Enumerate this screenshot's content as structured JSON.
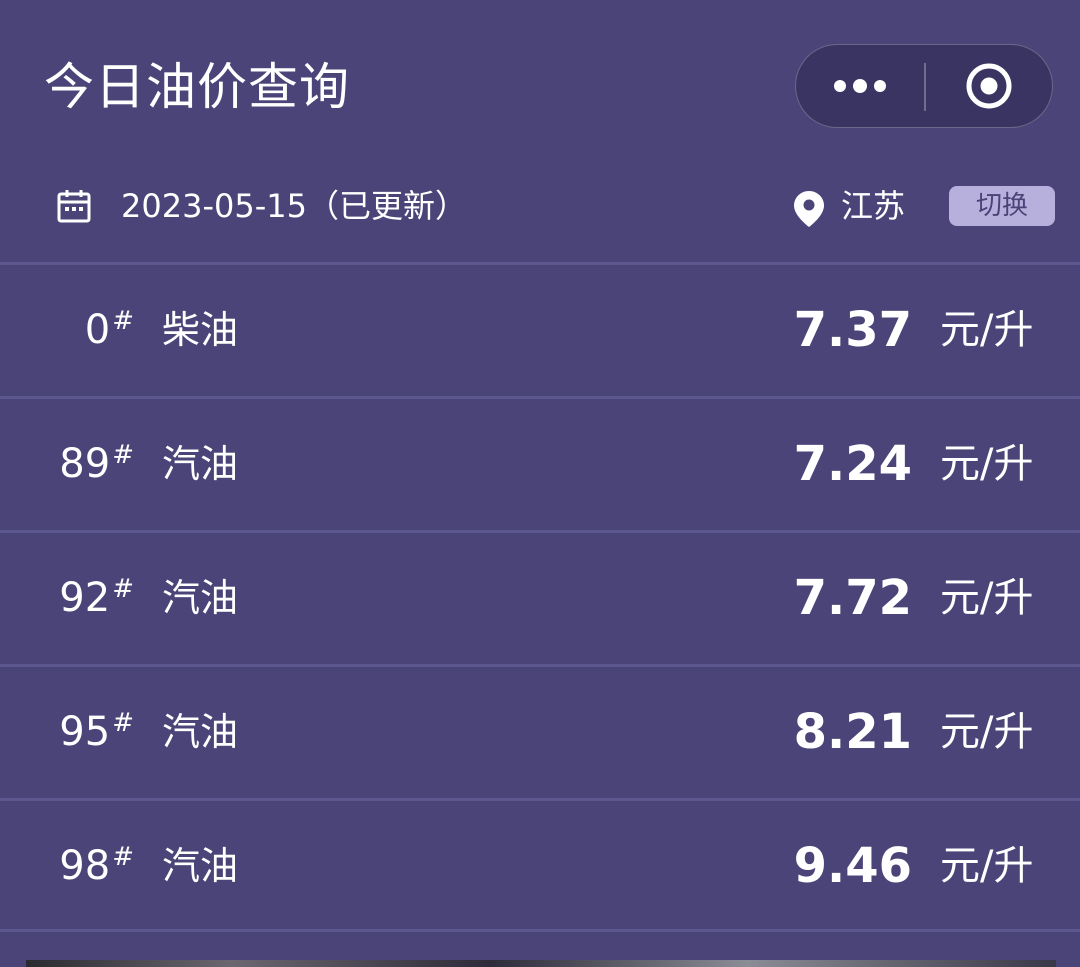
{
  "header": {
    "title": "今日油价查询",
    "capsule": {
      "more_icon": "more-dots-icon",
      "target_icon": "target-circle-icon"
    }
  },
  "info": {
    "date": "2023-05-15（已更新）",
    "province": "江苏",
    "switch_label": "切换",
    "calendar_icon": "calendar-icon",
    "location_icon": "location-pin-icon"
  },
  "prices": [
    {
      "grade": "0",
      "mark": "#",
      "type": "柴油",
      "price": "7.37",
      "unit": "元/升"
    },
    {
      "grade": "89",
      "mark": "#",
      "type": "汽油",
      "price": "7.24",
      "unit": "元/升"
    },
    {
      "grade": "92",
      "mark": "#",
      "type": "汽油",
      "price": "7.72",
      "unit": "元/升"
    },
    {
      "grade": "95",
      "mark": "#",
      "type": "汽油",
      "price": "8.21",
      "unit": "元/升"
    },
    {
      "grade": "98",
      "mark": "#",
      "type": "汽油",
      "price": "9.46",
      "unit": "元/升"
    }
  ],
  "colors": {
    "background": "#4b4478",
    "divider": "#5d5790",
    "switch_bg": "#b8b0dc",
    "capsule_bg": "#3a3462"
  }
}
